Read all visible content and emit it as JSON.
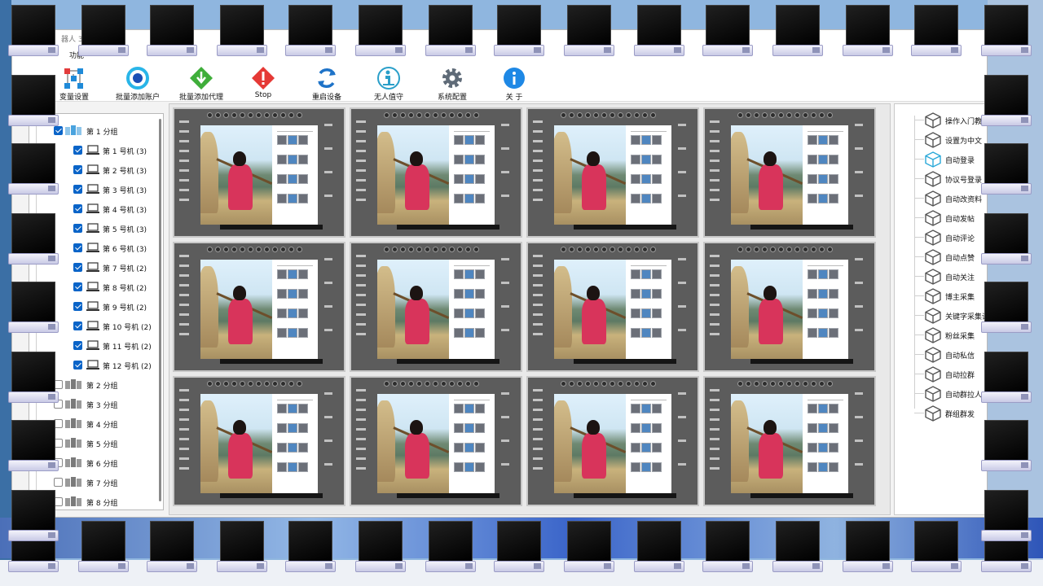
{
  "window": {
    "title": "器人 3"
  },
  "menu": {
    "function": "功能"
  },
  "toolbar": [
    {
      "name": "overlay-settings",
      "label": "变量设置",
      "icon": "nodes-icon"
    },
    {
      "name": "batch-add-account",
      "label": "批量添加账户",
      "icon": "circle-logo-icon"
    },
    {
      "name": "batch-add-proxy",
      "label": "批量添加代理",
      "icon": "download-diamond-icon"
    },
    {
      "name": "stop",
      "label": "Stop",
      "icon": "warning-diamond-icon"
    },
    {
      "name": "restart-device",
      "label": "重启设备",
      "icon": "refresh-icon"
    },
    {
      "name": "unattended",
      "label": "无人值守",
      "icon": "person-badge-icon"
    },
    {
      "name": "system-config",
      "label": "系统配置",
      "icon": "gear-icon"
    },
    {
      "name": "about",
      "label": "关 于",
      "icon": "info-icon"
    }
  ],
  "tree": {
    "group1": "第 1 分组",
    "devices": [
      {
        "label": "第 1 号机 (3)"
      },
      {
        "label": "第 2 号机 (3)"
      },
      {
        "label": "第 3 号机 (3)"
      },
      {
        "label": "第 4 号机 (3)"
      },
      {
        "label": "第 5 号机 (3)"
      },
      {
        "label": "第 6 号机 (3)"
      },
      {
        "label": "第 7 号机 (2)"
      },
      {
        "label": "第 8 号机 (2)"
      },
      {
        "label": "第 9 号机 (2)"
      },
      {
        "label": "第 10 号机 (2)"
      },
      {
        "label": "第 11 号机 (2)"
      },
      {
        "label": "第 12 号机 (2)"
      }
    ],
    "groups": [
      "第 2 分组",
      "第 3 分组",
      "第 4 分组",
      "第 5 分组",
      "第 6 分组",
      "第 7 分组",
      "第 8 分组"
    ]
  },
  "functions": [
    "操作入门教程",
    "设置为中文",
    "自动登录",
    "协议号登录",
    "自动改资料",
    "自动发帖",
    "自动评论",
    "自动点赞",
    "自动关注",
    "博主采集",
    "关键字采集评",
    "粉丝采集",
    "自动私信",
    "自动拉群",
    "自动群拉人",
    "群组群发"
  ],
  "functions_selected_index": 2,
  "colors": {
    "accent": "#0a64c8",
    "selected_cube": "#29a8d8"
  }
}
